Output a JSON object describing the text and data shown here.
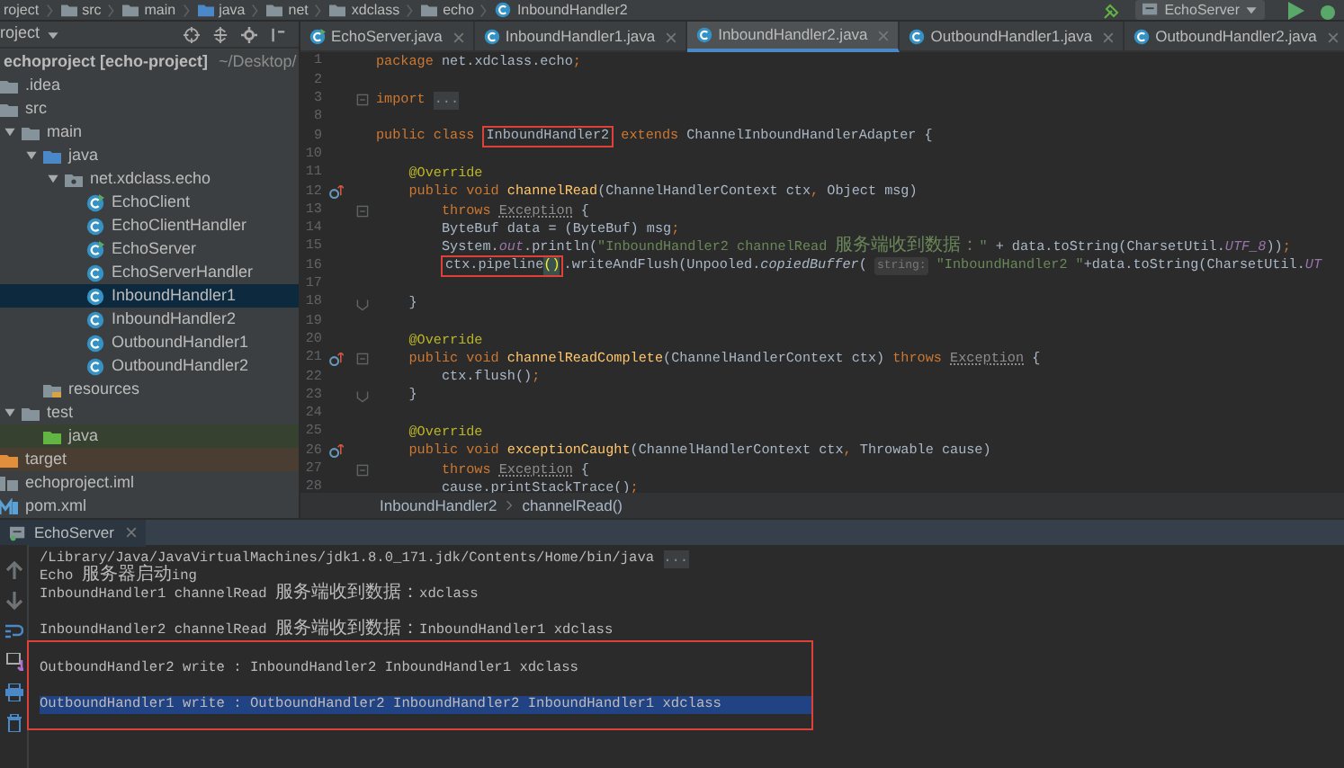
{
  "navbar": {
    "breadcrumbs": [
      {
        "label": "roject",
        "kind": "plain"
      },
      {
        "label": "src",
        "kind": "folder"
      },
      {
        "label": "main",
        "kind": "folder"
      },
      {
        "label": "java",
        "kind": "source-folder"
      },
      {
        "label": "net",
        "kind": "folder"
      },
      {
        "label": "xdclass",
        "kind": "folder"
      },
      {
        "label": "echo",
        "kind": "folder"
      },
      {
        "label": "InboundHandler2",
        "kind": "class"
      }
    ],
    "run_config": "EchoServer"
  },
  "sidebar": {
    "title": "roject",
    "tree": [
      {
        "label": "echoproject [echo-project]",
        "path": "~/Desktop/",
        "kind": "module",
        "selected": false,
        "children": [
          {
            "label": ".idea",
            "kind": "folder",
            "selected": false
          },
          {
            "label": "src",
            "kind": "folder",
            "selected": false,
            "children": [
              {
                "label": "main",
                "kind": "folder",
                "expanded": true,
                "selected": false,
                "children": [
                  {
                    "label": "java",
                    "kind": "source-folder",
                    "expanded": true,
                    "selected": false,
                    "children": [
                      {
                        "label": "net.xdclass.echo",
                        "kind": "package",
                        "expanded": true,
                        "selected": false,
                        "children": [
                          {
                            "label": "EchoClient",
                            "kind": "main-class",
                            "selected": false
                          },
                          {
                            "label": "EchoClientHandler",
                            "kind": "class",
                            "selected": false
                          },
                          {
                            "label": "EchoServer",
                            "kind": "main-class",
                            "selected": false
                          },
                          {
                            "label": "EchoServerHandler",
                            "kind": "class",
                            "selected": false
                          },
                          {
                            "label": "InboundHandler1",
                            "kind": "class",
                            "selected": true
                          },
                          {
                            "label": "InboundHandler2",
                            "kind": "class",
                            "selected": false
                          },
                          {
                            "label": "OutboundHandler1",
                            "kind": "class",
                            "selected": false
                          },
                          {
                            "label": "OutboundHandler2",
                            "kind": "class",
                            "selected": false
                          }
                        ]
                      }
                    ]
                  },
                  {
                    "label": "resources",
                    "kind": "resources-folder",
                    "selected": false
                  }
                ]
              },
              {
                "label": "test",
                "kind": "folder",
                "expanded": true,
                "selected": false,
                "children": [
                  {
                    "label": "java",
                    "kind": "test-folder",
                    "selected": false
                  }
                ]
              }
            ]
          },
          {
            "label": "target",
            "kind": "excluded-folder",
            "selected": false
          },
          {
            "label": "echoproject.iml",
            "kind": "iml-file",
            "selected": false
          },
          {
            "label": "pom.xml",
            "kind": "maven-file",
            "selected": false
          }
        ]
      }
    ]
  },
  "tabs": [
    {
      "label": "EchoServer.java",
      "kind": "main-class",
      "selected": false
    },
    {
      "label": "InboundHandler1.java",
      "kind": "class",
      "selected": false
    },
    {
      "label": "InboundHandler2.java",
      "kind": "class",
      "selected": true
    },
    {
      "label": "OutboundHandler1.java",
      "kind": "class",
      "selected": false
    },
    {
      "label": "OutboundHandler2.java",
      "kind": "class",
      "selected": false
    }
  ],
  "editor": {
    "lines": [
      {
        "number": "1",
        "tokens": [
          {
            "kind": "kw",
            "text": "package"
          },
          {
            "kind": "plain",
            "text": " net.xdclass.echo"
          },
          {
            "kind": "kw",
            "text": ";"
          }
        ]
      },
      {
        "number": "2"
      },
      {
        "number": "3",
        "fold_start": true,
        "tokens": [
          {
            "kind": "kw",
            "text": "import"
          },
          {
            "kind": "folded",
            "text": "..."
          }
        ]
      },
      {
        "number": "8"
      },
      {
        "number": "9",
        "tokens": [
          {
            "kind": "kw",
            "text": "public class "
          },
          {
            "kind": "plain",
            "text": "InboundHandler2",
            "boxed": true
          },
          {
            "kind": "kw",
            "text": " extends "
          },
          {
            "kind": "plain",
            "text": "ChannelInboundHandlerAdapter {"
          }
        ]
      },
      {
        "number": "10"
      },
      {
        "number": "11",
        "tokens": [
          {
            "kind": "ann",
            "text": "    @Override"
          }
        ]
      },
      {
        "number": "12",
        "override_marker": true,
        "tokens": [
          {
            "kind": "kw",
            "text": "    public void "
          },
          {
            "kind": "method",
            "text": "channelRead"
          },
          {
            "kind": "plain",
            "text": "(ChannelHandlerContext ctx"
          },
          {
            "kind": "kw",
            "text": ","
          },
          {
            "kind": "plain",
            "text": " Object msg)"
          }
        ]
      },
      {
        "number": "13",
        "fold_start": true,
        "tokens": [
          {
            "kind": "kw",
            "text": "        throws "
          },
          {
            "kind": "unresolved",
            "text": "Exception"
          },
          {
            "kind": "plain",
            "text": " {"
          }
        ]
      },
      {
        "number": "14",
        "tokens": [
          {
            "kind": "plain",
            "text": "        ByteBuf data = (ByteBuf) msg"
          },
          {
            "kind": "kw",
            "text": ";"
          }
        ]
      },
      {
        "number": "15",
        "tokens": [
          {
            "kind": "plain",
            "text": "        System."
          },
          {
            "kind": "field",
            "text": "out"
          },
          {
            "kind": "plain",
            "text": ".println("
          },
          {
            "kind": "str",
            "text": "\"InboundHandler2 channelRead 服务端收到数据：\""
          },
          {
            "kind": "plain",
            "text": " + data.toString(CharsetUtil."
          },
          {
            "kind": "field",
            "text": "UTF_8"
          },
          {
            "kind": "plain",
            "text": "))"
          },
          {
            "kind": "kw",
            "text": ";"
          }
        ]
      },
      {
        "number": "16",
        "tokens": [
          {
            "kind": "plain",
            "text": "        ctx.pipeline",
            "boxed": true
          },
          {
            "kind": "brace",
            "text": "()",
            "boxed": true
          },
          {
            "kind": "plain",
            "text": ".writeAndFlush(Unpooled."
          },
          {
            "kind": "static",
            "text": "copiedBuffer"
          },
          {
            "kind": "plain",
            "text": "( "
          },
          {
            "kind": "hint",
            "text": "string:"
          },
          {
            "kind": "str",
            "text": " \"InboundHandler2 \""
          },
          {
            "kind": "plain",
            "text": "+data.toString(CharsetUtil."
          },
          {
            "kind": "field",
            "text": "UT"
          }
        ]
      },
      {
        "number": "17"
      },
      {
        "number": "18",
        "fold_end": true,
        "tokens": [
          {
            "kind": "plain",
            "text": "    }"
          }
        ]
      },
      {
        "number": "19"
      },
      {
        "number": "20",
        "tokens": [
          {
            "kind": "ann",
            "text": "    @Override"
          }
        ]
      },
      {
        "number": "21",
        "override_marker": true,
        "fold_start": true,
        "tokens": [
          {
            "kind": "kw",
            "text": "    public void "
          },
          {
            "kind": "method",
            "text": "channelReadComplete"
          },
          {
            "kind": "plain",
            "text": "(ChannelHandlerContext ctx) "
          },
          {
            "kind": "kw",
            "text": "throws "
          },
          {
            "kind": "unresolved",
            "text": "Exception"
          },
          {
            "kind": "plain",
            "text": " {"
          }
        ]
      },
      {
        "number": "22",
        "tokens": [
          {
            "kind": "plain",
            "text": "        ctx.flush()"
          },
          {
            "kind": "kw",
            "text": ";"
          }
        ]
      },
      {
        "number": "23",
        "fold_end": true,
        "tokens": [
          {
            "kind": "plain",
            "text": "    }"
          }
        ]
      },
      {
        "number": "24"
      },
      {
        "number": "25",
        "tokens": [
          {
            "kind": "ann",
            "text": "    @Override"
          }
        ]
      },
      {
        "number": "26",
        "override_marker": true,
        "tokens": [
          {
            "kind": "kw",
            "text": "    public void "
          },
          {
            "kind": "method",
            "text": "exceptionCaught"
          },
          {
            "kind": "plain",
            "text": "(ChannelHandlerContext ctx"
          },
          {
            "kind": "kw",
            "text": ","
          },
          {
            "kind": "plain",
            "text": " Throwable cause)"
          }
        ]
      },
      {
        "number": "27",
        "fold_start": true,
        "tokens": [
          {
            "kind": "kw",
            "text": "        throws "
          },
          {
            "kind": "unresolved",
            "text": "Exception"
          },
          {
            "kind": "plain",
            "text": " {"
          }
        ]
      },
      {
        "number": "28",
        "tokens": [
          {
            "kind": "plain",
            "text": "        cause.printStackTrace()"
          },
          {
            "kind": "kw",
            "text": ";"
          }
        ]
      }
    ],
    "breadcrumb": [
      "InboundHandler2",
      "channelRead()"
    ]
  },
  "run": {
    "tab": "EchoServer",
    "console": [
      {
        "text": "/Library/Java/JavaVirtualMachines/jdk1.8.0_171.jdk/Contents/Home/bin/java",
        "folded": "...",
        "blank_before": false,
        "boxed": false,
        "selected": false
      },
      {
        "text": "Echo 服务器启动ing",
        "blank_before": false,
        "boxed": false,
        "selected": false
      },
      {
        "text": "InboundHandler1 channelRead 服务端收到数据：xdclass",
        "blank_before": false,
        "boxed": false,
        "selected": false
      },
      {
        "text": "InboundHandler2 channelRead 服务端收到数据：InboundHandler1 xdclass",
        "blank_before": true,
        "boxed": false,
        "selected": false
      },
      {
        "text": "OutboundHandler2 write : InboundHandler2 InboundHandler1 xdclass",
        "blank_before": true,
        "boxed": true,
        "selected": false
      },
      {
        "text": "OutboundHandler1 write : OutboundHandler2 InboundHandler2 InboundHandler1 xdclass",
        "blank_before": true,
        "boxed": true,
        "selected": true
      }
    ]
  }
}
